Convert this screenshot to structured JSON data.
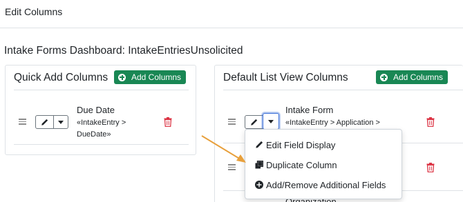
{
  "header": {
    "title": "Edit Columns"
  },
  "page": {
    "subtitle": "Intake Forms Dashboard: IntakeEntriesUnsolicited"
  },
  "quick_add": {
    "title": "Quick Add Columns",
    "add_label": "Add Columns",
    "rows": [
      {
        "name": "Due Date",
        "path_line1": "«IntakeEntry >",
        "path_line2": "DueDate»"
      }
    ]
  },
  "default_list": {
    "title": "Default List View Columns",
    "add_label": "Add Columns",
    "rows": [
      {
        "name": "Intake Form",
        "path_line1": "«IntakeEntry > Application >"
      },
      {
        "name": "Organization"
      }
    ]
  },
  "dropdown": {
    "items": [
      {
        "label": "Edit Field Display",
        "icon": "pencil-icon"
      },
      {
        "label": "Duplicate Column",
        "icon": "copy-icon"
      },
      {
        "label": "Add/Remove Additional Fields",
        "icon": "plus-circle-icon"
      }
    ]
  },
  "colors": {
    "accent_green": "#198754",
    "danger": "#dc3545",
    "focus_blue": "#3b6fd8",
    "arrow_orange": "#e8a03c"
  }
}
